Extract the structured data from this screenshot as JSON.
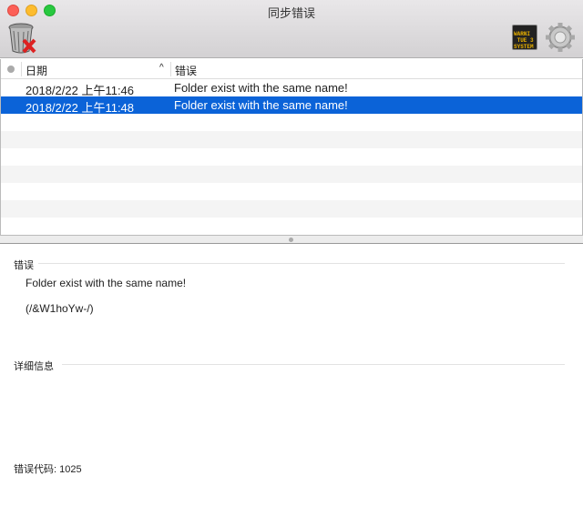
{
  "window": {
    "title": "同步错误"
  },
  "toolbar": {
    "delete_icon": "trash-with-x-icon",
    "log_icon": "warning-console-icon",
    "log_icon_text": "WARNI TUE 3 SYSTEM",
    "settings_icon": "gear-icon"
  },
  "table": {
    "columns": {
      "status": "",
      "date": "日期",
      "error": "错误"
    },
    "rows": [
      {
        "date": "2018/2/22 上午11:46",
        "error": "Folder exist with the same name!",
        "selected": false
      },
      {
        "date": "2018/2/22 上午11:48",
        "error": "Folder exist with the same name!",
        "selected": true
      }
    ]
  },
  "detail": {
    "error_label": "错误",
    "error_message": "Folder exist with the same name!",
    "error_path": "(/&W1hoYw-/)",
    "info_label": "详细信息",
    "error_code": "错误代码: 1025"
  },
  "colors": {
    "selection": "#0b63d8"
  }
}
